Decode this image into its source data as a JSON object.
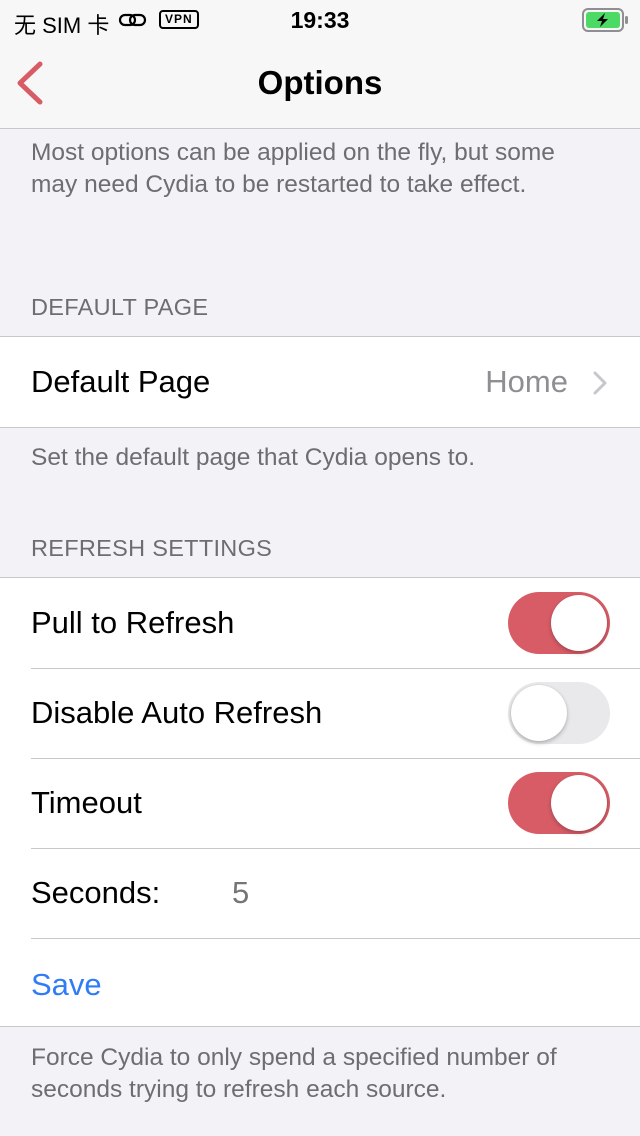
{
  "status_bar": {
    "carrier": "无 SIM 卡",
    "vpn": "VPN",
    "time": "19:33"
  },
  "nav": {
    "title": "Options"
  },
  "intro_note": "Most options can be applied on the fly, but some may need Cydia to be restarted to take effect.",
  "default_page_section": {
    "header": "DEFAULT PAGE",
    "row_label": "Default Page",
    "row_value": "Home",
    "footer": "Set the default page that Cydia opens to."
  },
  "refresh_section": {
    "header": "REFRESH SETTINGS",
    "pull_to_refresh": {
      "label": "Pull to Refresh",
      "on": true
    },
    "disable_auto_refresh": {
      "label": "Disable Auto Refresh",
      "on": false
    },
    "timeout": {
      "label": "Timeout",
      "on": true
    },
    "seconds": {
      "label": "Seconds:",
      "placeholder": "5"
    },
    "save_label": "Save",
    "footer": "Force Cydia to only spend a specified number of seconds trying to refresh each source."
  },
  "colors": {
    "accent_red": "#d85c66",
    "link_blue": "#2f7cf6",
    "battery_green": "#4cd964"
  },
  "icons": [
    "link-icon",
    "battery-charging-icon",
    "back-chevron-icon",
    "disclosure-chevron-icon"
  ]
}
